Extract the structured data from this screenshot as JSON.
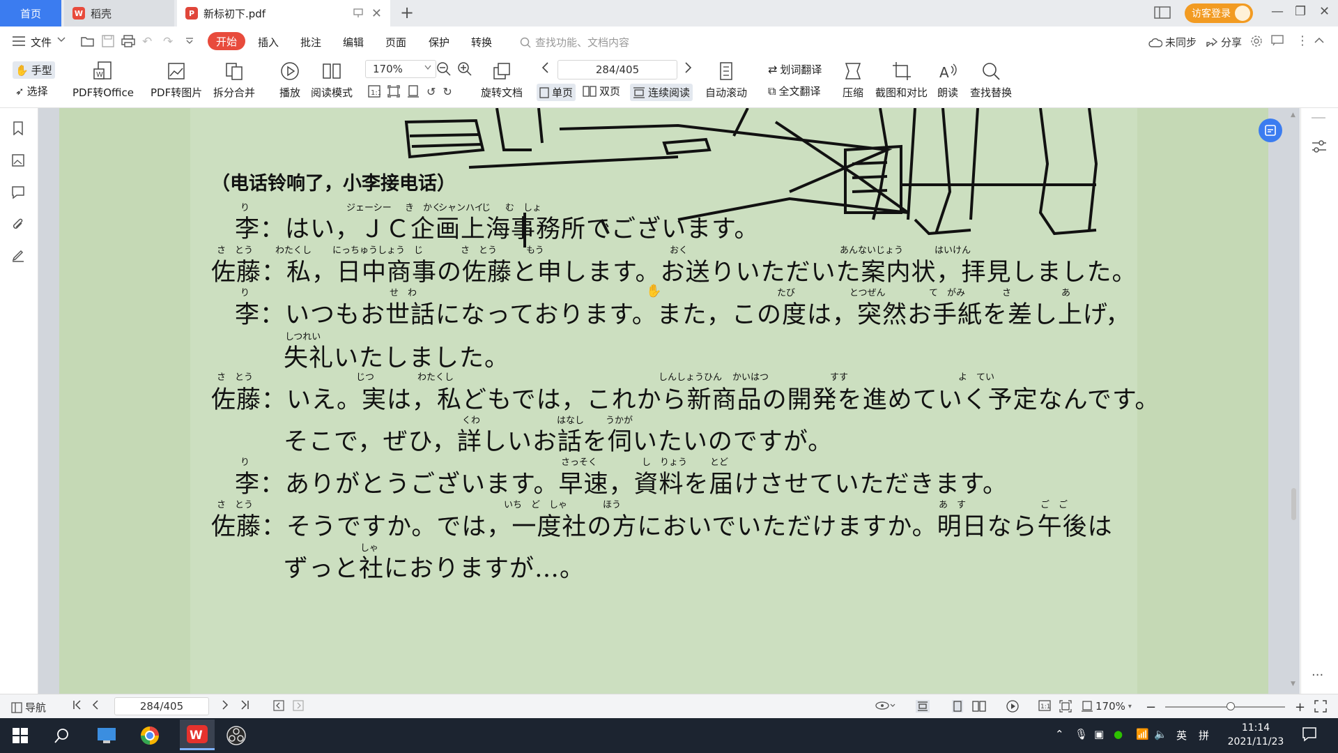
{
  "tabs": {
    "home": "首页",
    "daoke": "稻壳",
    "document": "新标初下.pdf"
  },
  "titlebar": {
    "login": "访客登录"
  },
  "menu": {
    "file": "文件",
    "start": "开始",
    "insert": "插入",
    "annotate": "批注",
    "edit": "编辑",
    "page": "页面",
    "protect": "保护",
    "convert": "转换",
    "search_placeholder": "查找功能、文档内容",
    "unsynced": "未同步",
    "share": "分享"
  },
  "ribbon": {
    "hand": "手型",
    "select": "选择",
    "pdf_to_office": "PDF转Office",
    "pdf_to_image": "PDF转图片",
    "split_merge": "拆分合并",
    "play": "播放",
    "read_mode": "阅读模式",
    "zoom": "170%",
    "rotate_doc": "旋转文档",
    "page_indicator": "284/405",
    "single_page": "单页",
    "double_page": "双页",
    "continuous": "连续阅读",
    "auto_scroll": "自动滚动",
    "word_translate": "划词翻译",
    "full_translate": "全文翻译",
    "compress": "压缩",
    "screenshot_compare": "截图和对比",
    "read_aloud": "朗读",
    "find_replace": "查找替换"
  },
  "document": {
    "heading": "（电话铃响了，小李接电话）",
    "lines": [
      {
        "speaker": "李：",
        "text": "はい，ＪＣ企画上海事務所でございます。"
      },
      {
        "speaker": "佐藤：",
        "text": "私，日中商事の佐藤と申します。お送りいただいた案内状，拝見しました。"
      },
      {
        "speaker": "李：",
        "text": "いつもお世話になっております。また，この度は，突然お手紙を差し上げ，"
      },
      {
        "speaker": "",
        "text": "失礼いたしました。"
      },
      {
        "speaker": "佐藤：",
        "text": "いえ。実は，私どもでは，これから新商品の開発を進めていく予定なんです。"
      },
      {
        "speaker": "",
        "text": "そこで，ぜひ，詳しいお話を伺いたいのですが。"
      },
      {
        "speaker": "李：",
        "text": "ありがとうございます。早速，資料を届けさせていただきます。"
      },
      {
        "speaker": "佐藤：",
        "text": "そうですか。では，一度社の方においでいただけますか。明日なら午後は"
      },
      {
        "speaker": "",
        "text": "ずっと社におりますが…。"
      }
    ],
    "ruby": [
      "り",
      "ジェーシー",
      "き　かく",
      "シャンハイ",
      "じ",
      "む　しょ",
      "さ　とう",
      "わたくし",
      "にっちゅうしょう　じ",
      "さ　とう",
      "もう",
      "おく",
      "あんないじょう",
      "はいけん",
      "り",
      "せ　わ",
      "たび",
      "とつぜん",
      "て　がみ",
      "さ",
      "あ",
      "しつれい",
      "さ　とう",
      "じつ",
      "わたくし",
      "しんしょうひん",
      "かいはつ",
      "すす",
      "よ　てい",
      "くわ",
      "はなし",
      "うかが",
      "り",
      "さっそく",
      "し　りょう",
      "とど",
      "さ　とう",
      "いち　ど　しゃ",
      "ほう",
      "あ　す",
      "ご　ご",
      "しゃ"
    ]
  },
  "statusbar": {
    "nav": "导航",
    "page": "284/405",
    "zoom": "170%"
  },
  "taskbar": {
    "time": "11:14",
    "date": "2021/11/23",
    "ime_lang": "英",
    "ime_mode": "拼"
  }
}
